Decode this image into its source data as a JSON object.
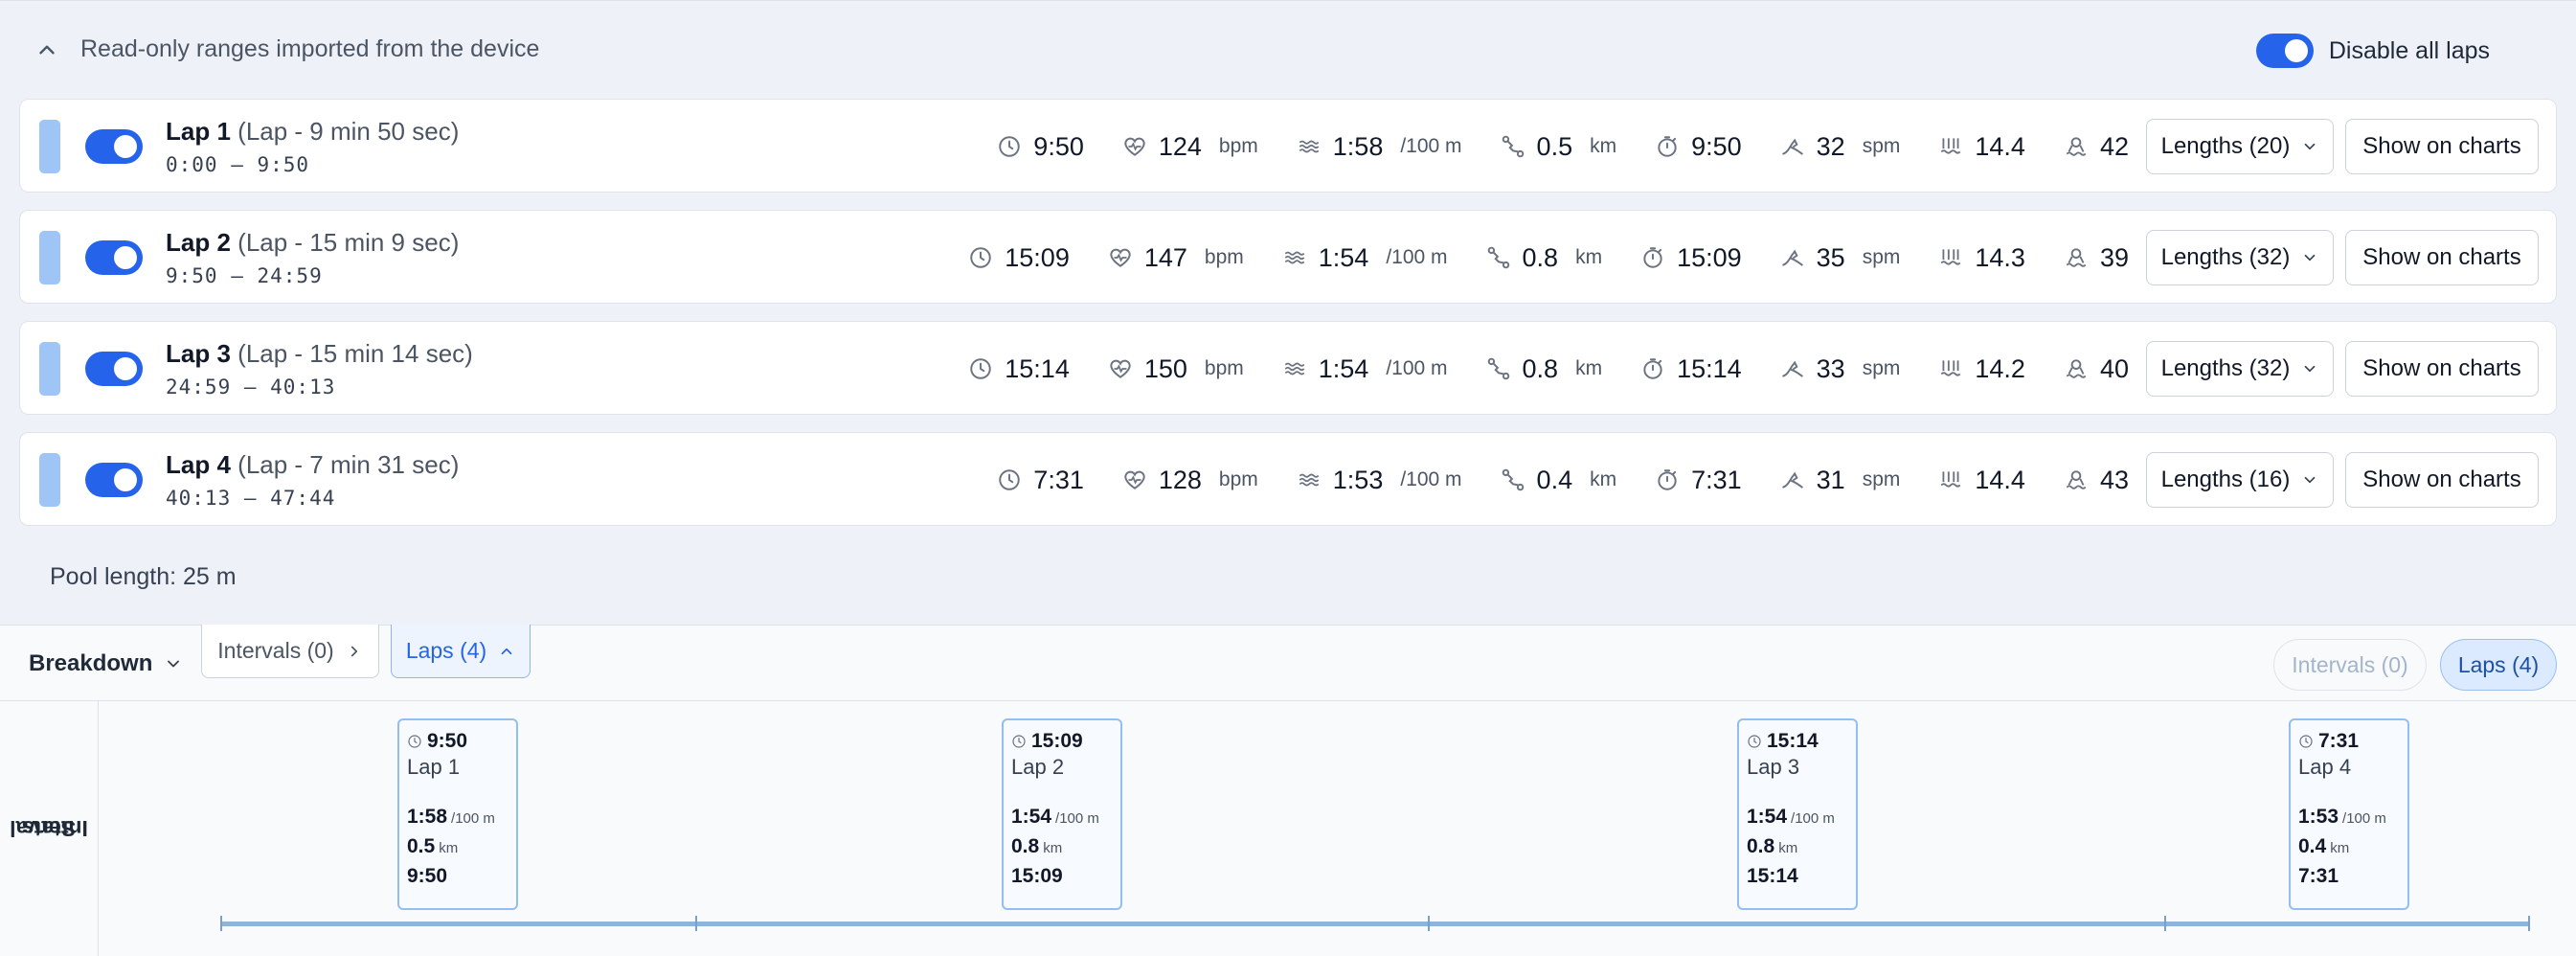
{
  "header": {
    "title": "Read-only ranges imported from the device",
    "disable_all_label": "Disable all laps"
  },
  "laps": [
    {
      "name": "Lap 1",
      "subtitle": "(Lap - 9 min 50 sec)",
      "range": "0:00 — 9:50",
      "time": "9:50",
      "hr": "124",
      "hr_unit": "bpm",
      "pace": "1:58",
      "pace_unit": "/100 m",
      "distance": "0.5",
      "distance_unit": "km",
      "moving_time": "9:50",
      "stroke_rate": "32",
      "stroke_rate_unit": "spm",
      "swolf": "14.4",
      "strokes": "42",
      "lengths_label": "Lengths (20)",
      "show_label": "Show on charts"
    },
    {
      "name": "Lap 2",
      "subtitle": "(Lap - 15 min 9 sec)",
      "range": "9:50 — 24:59",
      "time": "15:09",
      "hr": "147",
      "hr_unit": "bpm",
      "pace": "1:54",
      "pace_unit": "/100 m",
      "distance": "0.8",
      "distance_unit": "km",
      "moving_time": "15:09",
      "stroke_rate": "35",
      "stroke_rate_unit": "spm",
      "swolf": "14.3",
      "strokes": "39",
      "lengths_label": "Lengths (32)",
      "show_label": "Show on charts"
    },
    {
      "name": "Lap 3",
      "subtitle": "(Lap - 15 min 14 sec)",
      "range": "24:59 — 40:13",
      "time": "15:14",
      "hr": "150",
      "hr_unit": "bpm",
      "pace": "1:54",
      "pace_unit": "/100 m",
      "distance": "0.8",
      "distance_unit": "km",
      "moving_time": "15:14",
      "stroke_rate": "33",
      "stroke_rate_unit": "spm",
      "swolf": "14.2",
      "strokes": "40",
      "lengths_label": "Lengths (32)",
      "show_label": "Show on charts"
    },
    {
      "name": "Lap 4",
      "subtitle": "(Lap - 7 min 31 sec)",
      "range": "40:13 — 47:44",
      "time": "7:31",
      "hr": "128",
      "hr_unit": "bpm",
      "pace": "1:53",
      "pace_unit": "/100 m",
      "distance": "0.4",
      "distance_unit": "km",
      "moving_time": "7:31",
      "stroke_rate": "31",
      "stroke_rate_unit": "spm",
      "swolf": "14.4",
      "strokes": "43",
      "lengths_label": "Lengths (16)",
      "show_label": "Show on charts"
    }
  ],
  "pool_length": "Pool length: 25 m",
  "breakdown": {
    "label": "Breakdown",
    "tab_intervals": "Intervals (0)",
    "tab_laps": "Laps (4)",
    "pill_intervals": "Intervals (0)",
    "pill_laps": "Laps (4)"
  },
  "interval_stats": {
    "side_label_line1": "Interval",
    "side_label_line2": "Stats",
    "cards": [
      {
        "duration": "9:50",
        "name": "Lap 1",
        "pace": "1:58",
        "pace_unit": "/100 m",
        "distance": "0.5",
        "distance_unit": "km",
        "time": "9:50"
      },
      {
        "duration": "15:09",
        "name": "Lap 2",
        "pace": "1:54",
        "pace_unit": "/100 m",
        "distance": "0.8",
        "distance_unit": "km",
        "time": "15:09"
      },
      {
        "duration": "15:14",
        "name": "Lap 3",
        "pace": "1:54",
        "pace_unit": "/100 m",
        "distance": "0.8",
        "distance_unit": "km",
        "time": "15:14"
      },
      {
        "duration": "7:31",
        "name": "Lap 4",
        "pace": "1:53",
        "pace_unit": "/100 m",
        "distance": "0.4",
        "distance_unit": "km",
        "time": "7:31"
      }
    ]
  },
  "colors": {
    "accent": "#2563eb",
    "lap_bar": "#9ec5f5",
    "card_border": "#93bff0",
    "icon": "#6b7280"
  },
  "icons": [
    "chevron-up-icon",
    "clock-icon",
    "heart-rate-icon",
    "swim-pace-icon",
    "distance-route-icon",
    "stopwatch-icon",
    "stroke-rate-icon",
    "swolf-icon",
    "strokes-icon",
    "chevron-down-icon",
    "chevron-right-icon"
  ]
}
